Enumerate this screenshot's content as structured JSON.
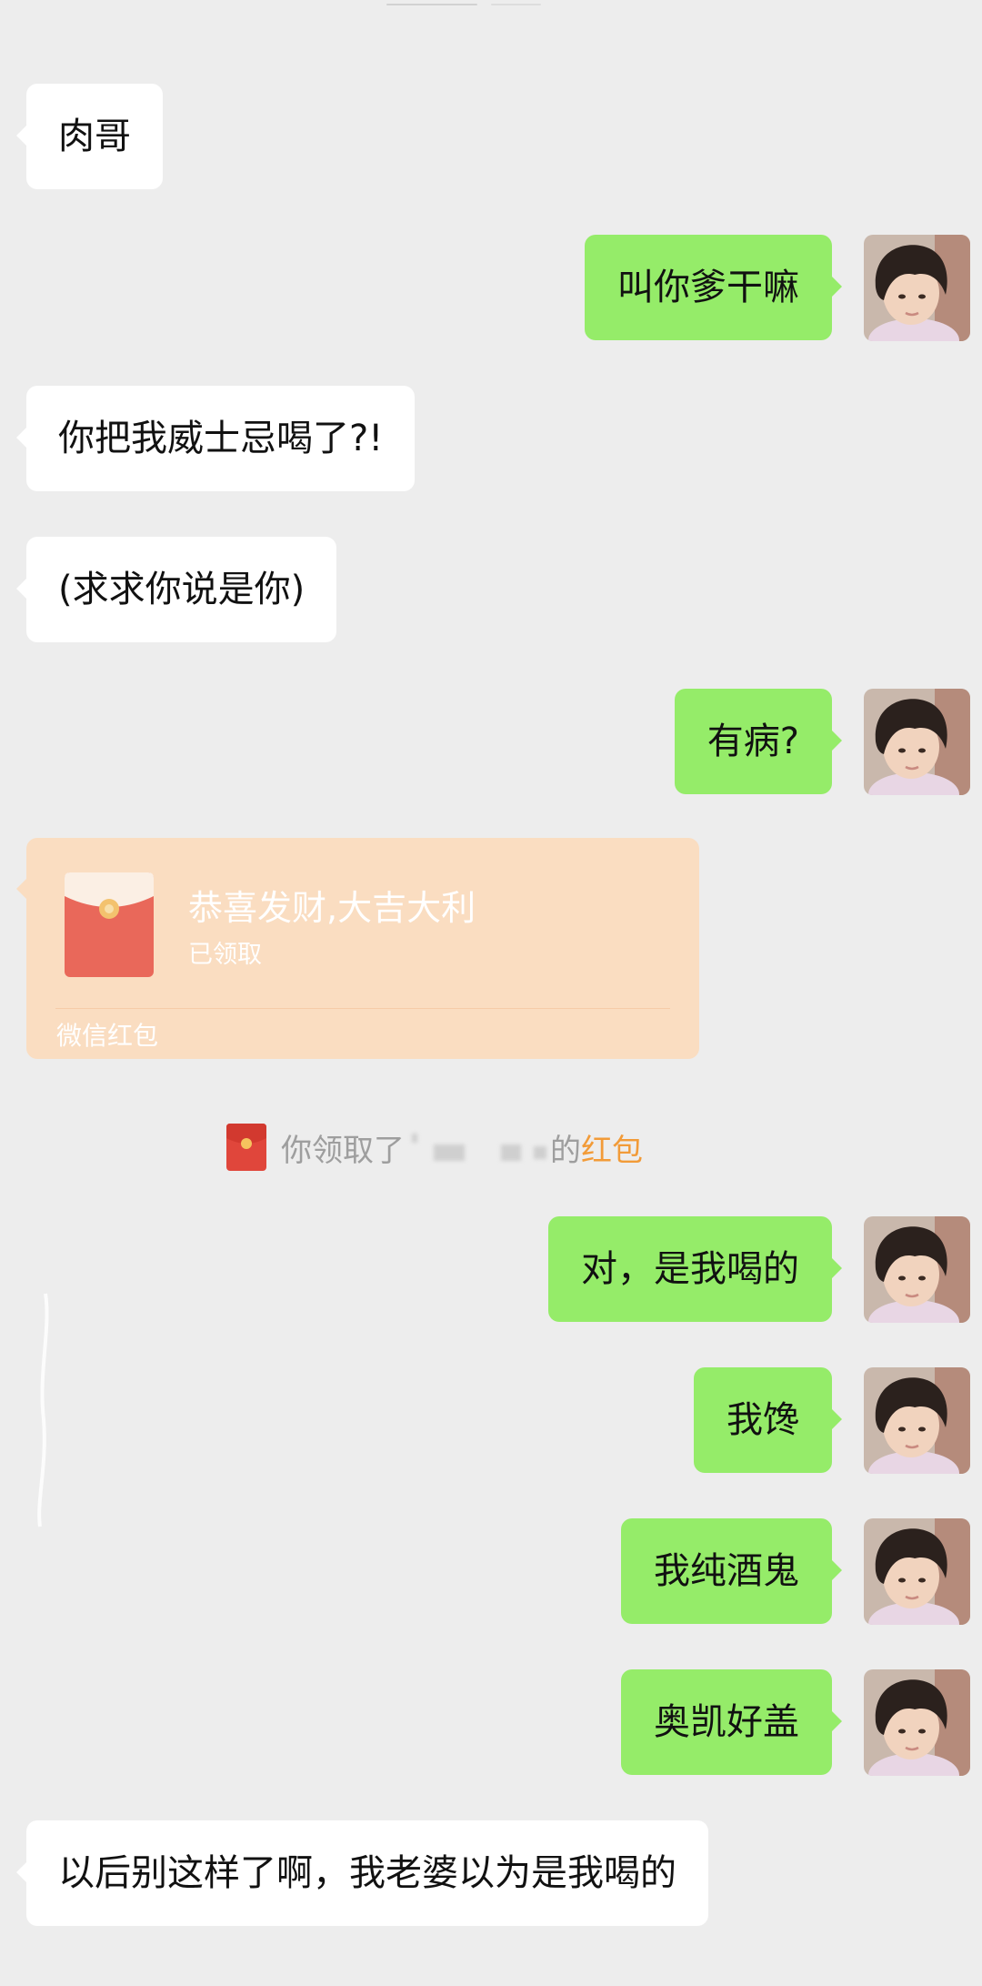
{
  "messages": [
    {
      "id": "m1",
      "side": "incoming",
      "text": "肉哥"
    },
    {
      "id": "m2",
      "side": "outgoing",
      "text": "叫你爹干嘛"
    },
    {
      "id": "m3",
      "side": "incoming",
      "text": "你把我威士忌喝了?!"
    },
    {
      "id": "m4",
      "side": "incoming",
      "text": "(求求你说是你)"
    },
    {
      "id": "m5",
      "side": "outgoing",
      "text": "有病?"
    },
    {
      "id": "m6",
      "side": "outgoing",
      "text": "对，是我喝的"
    },
    {
      "id": "m7",
      "side": "outgoing",
      "text": "我馋"
    },
    {
      "id": "m8",
      "side": "outgoing",
      "text": "我纯酒鬼"
    },
    {
      "id": "m9",
      "side": "outgoing",
      "text": "奥凯好盖"
    },
    {
      "id": "m10",
      "side": "incoming",
      "text": "以后别这样了啊，我老婆以为是我喝的"
    }
  ],
  "red_packet": {
    "title": "恭喜发财,大吉大利",
    "status": "已领取",
    "brand": "微信红包",
    "color": "#FADDC1",
    "icon": "red-envelope-icon"
  },
  "system_notice": {
    "prefix": "你领取了",
    "suffix": "的",
    "link_text": "红包",
    "link_color": "#F29B38",
    "icon": "red-envelope-icon"
  },
  "colors": {
    "background": "#EDEDED",
    "incoming_bubble": "#FFFFFF",
    "outgoing_bubble": "#95EC69"
  }
}
